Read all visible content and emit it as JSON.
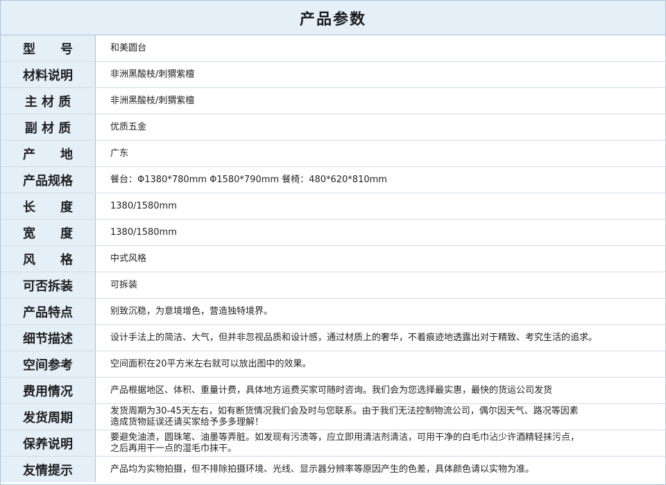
{
  "title": "产品参数",
  "rows": [
    {
      "label": "型　　号",
      "value": "和美圆台"
    },
    {
      "label": "材料说明",
      "value": "非洲黑酸枝/刺猬紫檀"
    },
    {
      "label": "主 材 质",
      "value": "非洲黑酸枝/刺猬紫檀"
    },
    {
      "label": "副 材 质",
      "value": "优质五金"
    },
    {
      "label": "产　　地",
      "value": "广东"
    },
    {
      "label": "产品规格",
      "value": "餐台：Φ1380*780mm Φ1580*790mm 餐椅：480*620*810mm"
    },
    {
      "label": "长　　度",
      "value": "1380/1580mm"
    },
    {
      "label": "宽　　度",
      "value": "1380/1580mm"
    },
    {
      "label": "风　　格",
      "value": "中式风格"
    },
    {
      "label": "可否拆装",
      "value": "可拆装"
    },
    {
      "label": "产品特点",
      "value": "别致沉稳，为意境增色，营造独特境界。"
    },
    {
      "label": "细节描述",
      "value": "设计手法上的简洁、大气，但并非忽视品质和设计感，通过材质上的奢华，不着痕迹地透露出对于精致、考究生活的追求。"
    },
    {
      "label": "空间参考",
      "value": "空间面积在20平方米左右就可以放出图中的效果。"
    },
    {
      "label": "费用情况",
      "value": "产品根据地区、体积、重量计费，具体地方运费买家可随时咨询。我们会为您选择最实惠，最快的货运公司发货"
    },
    {
      "label": "发货周期",
      "value": "发货周期为30-45天左右，如有断货情况我们会及时与您联系。由于我们无法控制物流公司，偶尔因天气、路况等因素",
      "value2": "造成货物延误还请买家给予多多理解！"
    },
    {
      "label": "保养说明",
      "value": "要避免油渍，圆珠笔、油墨等弄脏。如发现有污渍等，应立即用清洁剂清洁，可用干净的白毛巾沾少许酒精轻抹污点，",
      "value2": "之后再用干一点的湿毛巾抹干。"
    },
    {
      "label": "友情提示",
      "value": "产品均为实物拍摄，但不排除拍摄环境、光线、显示器分辨率等原因产生的色差，具体颜色请以实物为准。"
    }
  ]
}
